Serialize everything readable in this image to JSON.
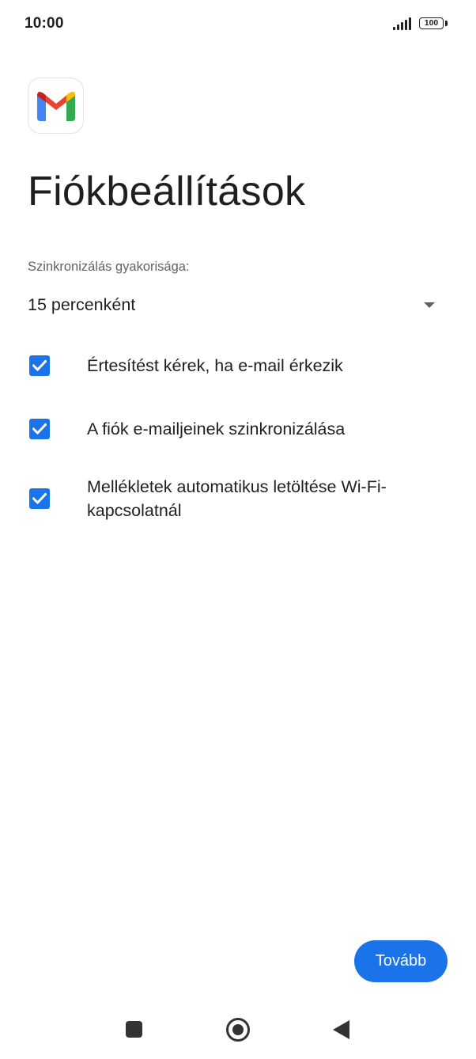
{
  "status_bar": {
    "time": "10:00",
    "battery_level": "100",
    "signal_icon": "signal-bars-icon"
  },
  "app": {
    "logo_icon": "gmail-logo-icon",
    "brand_colors": {
      "red": "#EA4335",
      "blue": "#4285F4",
      "green": "#34A853",
      "yellow": "#FBBC04",
      "dark_red": "#C5221F"
    }
  },
  "page": {
    "title": "Fiókbeállítások"
  },
  "sync": {
    "label": "Szinkronizálás gyakorisága:",
    "selected_value": "15 percenként"
  },
  "options": [
    {
      "label": "Értesítést kérek, ha e-mail érkezik",
      "checked": true
    },
    {
      "label": "A fiók e-mailjeinek szinkronizálása",
      "checked": true
    },
    {
      "label": "Mellékletek automatikus letöltése Wi-Fi-kapcsolatnál",
      "checked": true
    }
  ],
  "actions": {
    "next_label": "Tovább"
  },
  "accent_color": "#1A73E8",
  "nav_bar": {
    "recents_icon": "square-recents-icon",
    "home_icon": "circle-home-icon",
    "back_icon": "triangle-back-icon"
  }
}
